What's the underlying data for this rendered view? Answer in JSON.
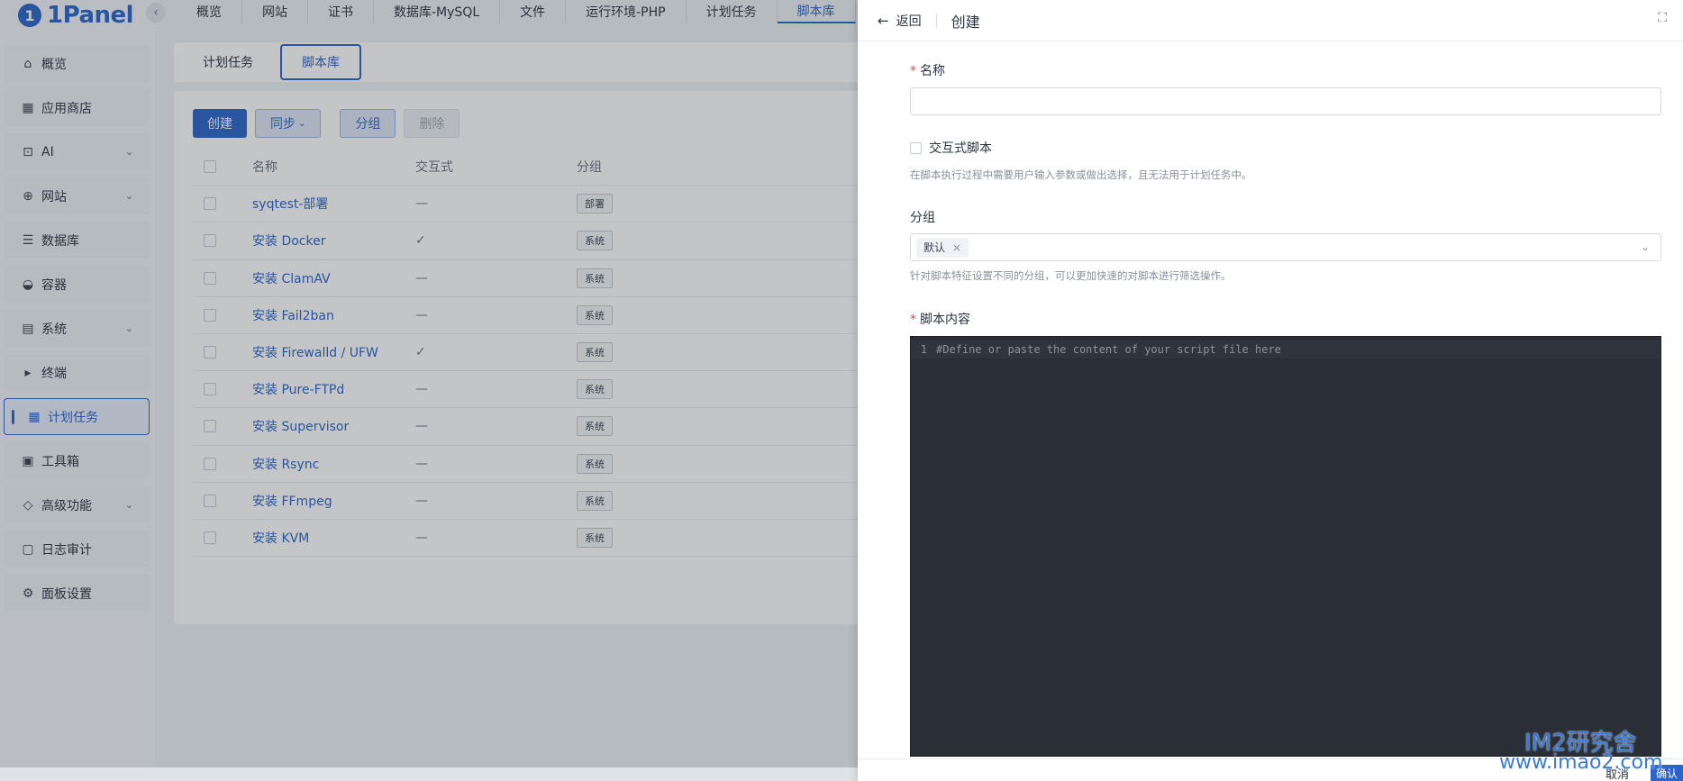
{
  "app": {
    "logo_text": "1Panel",
    "logo_mark": "1"
  },
  "sidebar": {
    "items": [
      {
        "label": "概览",
        "icon": "home-icon",
        "glyph": "⌂",
        "has_children": false
      },
      {
        "label": "应用商店",
        "icon": "grid-icon",
        "glyph": "▦",
        "has_children": false
      },
      {
        "label": "AI",
        "icon": "robot-icon",
        "glyph": "⊡",
        "has_children": true
      },
      {
        "label": "网站",
        "icon": "globe-icon",
        "glyph": "⊕",
        "has_children": true
      },
      {
        "label": "数据库",
        "icon": "database-icon",
        "glyph": "☰",
        "has_children": false
      },
      {
        "label": "容器",
        "icon": "docker-icon",
        "glyph": "◒",
        "has_children": false
      },
      {
        "label": "系统",
        "icon": "system-icon",
        "glyph": "▤",
        "has_children": true
      },
      {
        "label": "终端",
        "icon": "terminal-icon",
        "glyph": "▸",
        "has_children": false
      },
      {
        "label": "计划任务",
        "icon": "calendar-icon",
        "glyph": "▦",
        "has_children": false,
        "active": true
      },
      {
        "label": "工具箱",
        "icon": "toolbox-icon",
        "glyph": "▣",
        "has_children": false
      },
      {
        "label": "高级功能",
        "icon": "diamond-icon",
        "glyph": "◇",
        "has_children": true
      },
      {
        "label": "日志审计",
        "icon": "log-icon",
        "glyph": "▢",
        "has_children": false
      },
      {
        "label": "面板设置",
        "icon": "gear-icon",
        "glyph": "⚙",
        "has_children": false
      }
    ]
  },
  "topnav": [
    "概览",
    "网站",
    "证书",
    "数据库-MySQL",
    "文件",
    "运行环境-PHP",
    "计划任务",
    "脚本库"
  ],
  "subtabs": [
    "计划任务",
    "脚本库"
  ],
  "toolbar": {
    "create": "创建",
    "sync": "同步",
    "group": "分组",
    "delete": "删除"
  },
  "table": {
    "headers": {
      "name": "名称",
      "interactive": "交互式",
      "group": "分组"
    },
    "rows": [
      {
        "name": "syqtest-部署",
        "interactive": "—",
        "group": "部署"
      },
      {
        "name": "安装 Docker",
        "interactive": "✓",
        "group": "系统"
      },
      {
        "name": "安装 ClamAV",
        "interactive": "—",
        "group": "系统"
      },
      {
        "name": "安装 Fail2ban",
        "interactive": "—",
        "group": "系统"
      },
      {
        "name": "安装 Firewalld / UFW",
        "interactive": "✓",
        "group": "系统"
      },
      {
        "name": "安装 Pure-FTPd",
        "interactive": "—",
        "group": "系统"
      },
      {
        "name": "安装 Supervisor",
        "interactive": "—",
        "group": "系统"
      },
      {
        "name": "安装 Rsync",
        "interactive": "—",
        "group": "系统"
      },
      {
        "name": "安装 FFmpeg",
        "interactive": "—",
        "group": "系统"
      },
      {
        "name": "安装 KVM",
        "interactive": "—",
        "group": "系统"
      }
    ]
  },
  "drawer": {
    "back_label": "返回",
    "title": "创建",
    "name_label": "名称",
    "name_value": "",
    "interactive_label": "交互式脚本",
    "interactive_help": "在脚本执行过程中需要用户输入参数或做出选择，且无法用于计划任务中。",
    "group_label": "分组",
    "group_chip": "默认",
    "group_help": "针对脚本特征设置不同的分组，可以更加快速的对脚本进行筛选操作。",
    "content_label": "脚本内容",
    "editor_line_number": "1",
    "editor_placeholder": "#Define or paste the content of your script file here",
    "cancel": "取消",
    "confirm": "确认"
  },
  "watermark": {
    "line1": "IM2研究舍",
    "line2": "www.imao2.com"
  },
  "colors": {
    "accent": "#2c64c8",
    "required": "#e5484d",
    "editor_bg": "#2a2e36"
  }
}
